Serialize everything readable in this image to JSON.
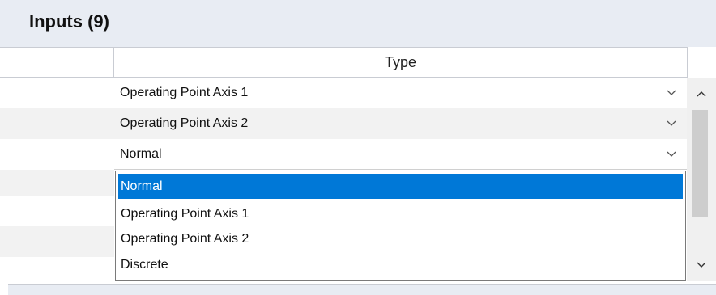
{
  "panel": {
    "title": "Inputs (9)"
  },
  "grid": {
    "column_header": "Type",
    "rows": [
      {
        "value": "Operating Point Axis 1",
        "bg": "#ffffff"
      },
      {
        "value": "Operating Point Axis 2",
        "bg": "#f2f2f2"
      },
      {
        "value": "Normal",
        "bg": "#ffffff"
      }
    ],
    "hidden_rows_bg": [
      "#f2f2f2",
      "#ffffff",
      "#f2f2f2",
      "#ffffff"
    ]
  },
  "dropdown": {
    "options": [
      "Normal",
      "Operating Point Axis 1",
      "Operating Point Axis 2",
      "Discrete"
    ],
    "selected_index": 0,
    "selected_color": "#0078d7"
  },
  "icons": {
    "chevron": "chevron-down-icon",
    "scroll_up": "scroll-up-arrow-icon",
    "scroll_down": "scroll-down-arrow-icon"
  }
}
